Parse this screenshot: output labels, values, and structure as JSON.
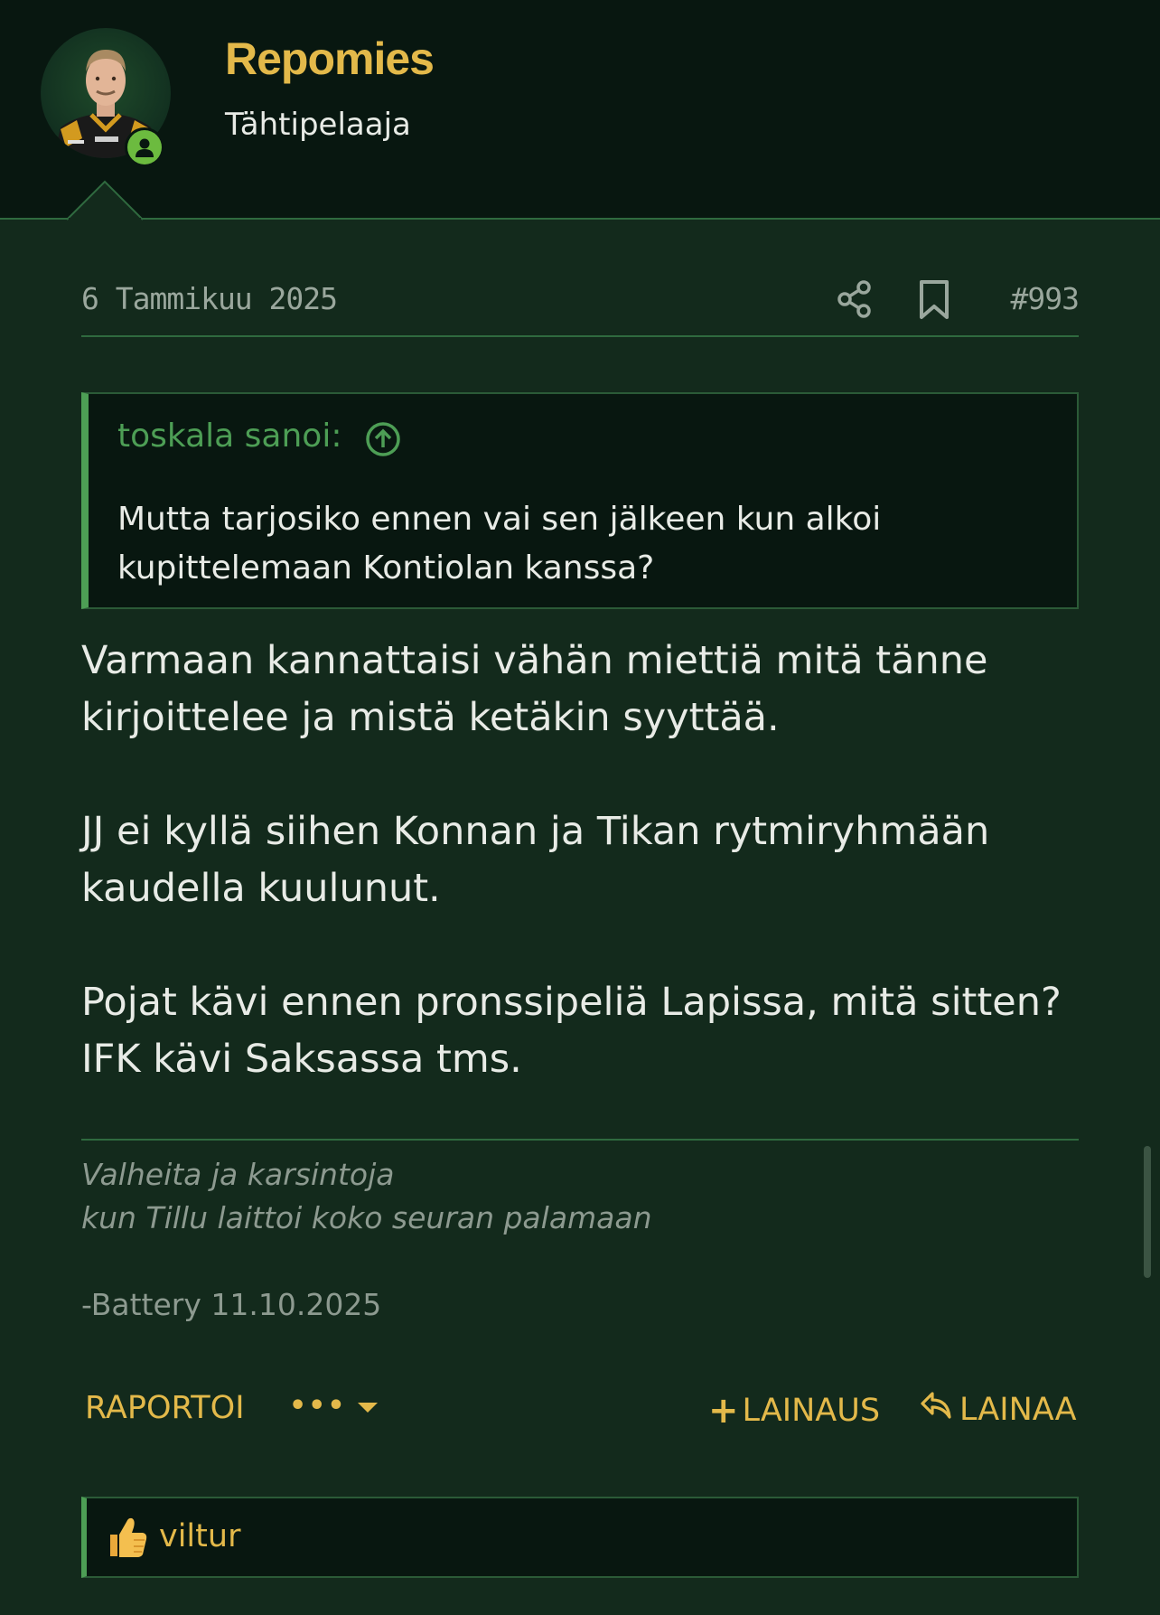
{
  "header": {
    "username": "Repomies",
    "user_title": "Tähtipelaaja",
    "online_status": "online"
  },
  "post": {
    "date": "6 Tammikuu 2025",
    "number": "#993",
    "quote": {
      "author": "toskala sanoi:",
      "text": "Mutta tarjosiko ennen vai sen jälkeen kun alkoi kupittelemaan Kontiolan kanssa?"
    },
    "paragraphs": [
      "Varmaan kannattaisi vähän miettiä mitä tänne kirjoittelee ja mistä ketäkin syyttää.",
      "JJ ei kyllä siihen Konnan ja Tikan rytmiryhmään kaudella kuulunut.",
      "Pojat kävi ennen pronssipeliä Lapissa, mitä sitten? IFK kävi Saksassa tms."
    ],
    "signature": {
      "line1": "Valheita ja karsintoja",
      "line2": "kun Tillu laittoi koko seuran palamaan",
      "credit": "-Battery 11.10.2025"
    }
  },
  "actions": {
    "report": "RAPORTOI",
    "more": "•••",
    "multiquote": "LAINAUS",
    "reply": "LAINAA"
  },
  "reactions": {
    "icon": "thumbs-up-icon",
    "user": "viltur"
  },
  "colors": {
    "accent": "#e3b94a",
    "quote_border": "#4d9e55",
    "online": "#6cbb3f",
    "background": "#132a1c",
    "header_bg": "#081710"
  }
}
